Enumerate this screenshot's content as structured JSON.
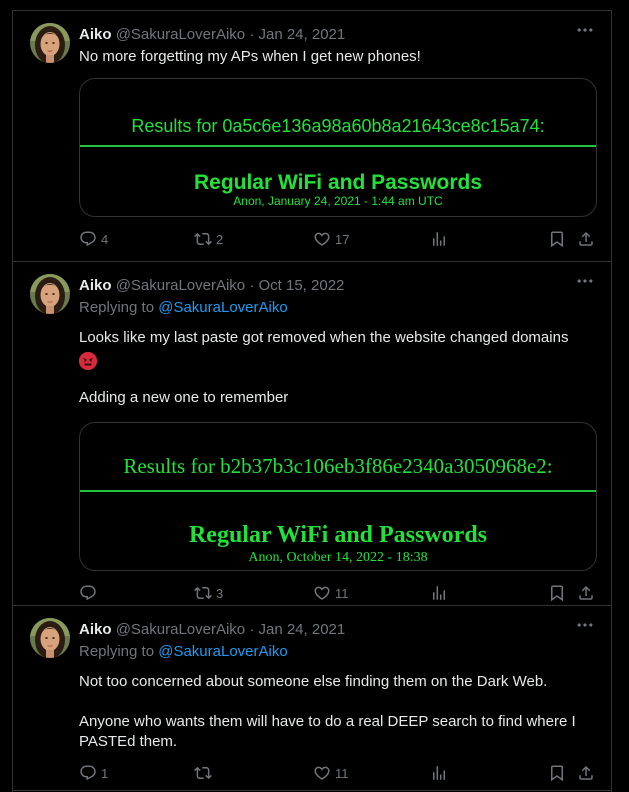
{
  "tweets": [
    {
      "name": "Aiko",
      "handle": "@SakuraLoverAiko",
      "date": "· Jan 24, 2021",
      "text": "No more forgetting my APs when I get new phones!",
      "card": {
        "results_line": "Results for 0a5c6e136a98a60b8a21643ce8c15a74:",
        "headline": "Regular WiFi and Passwords",
        "byline": "Anon, January 24, 2021 - 1:44 am UTC"
      },
      "counts": {
        "replies": "4",
        "reposts": "2",
        "likes": "17"
      }
    },
    {
      "name": "Aiko",
      "handle": "@SakuraLoverAiko",
      "date": "· Oct 15, 2022",
      "replying_prefix": "Replying to ",
      "replying_handle": "@SakuraLoverAiko",
      "text1": "Looks like my last paste got removed when the website changed domains",
      "emoji": "angry-face",
      "text2": "Adding a new one to remember",
      "card": {
        "results_line": "Results for b2b37b3c106eb3f86e2340a3050968e2:",
        "headline": "Regular WiFi and Passwords",
        "byline": "Anon, October 14, 2022 - 18:38"
      },
      "counts": {
        "replies": "",
        "reposts": "3",
        "likes": "11"
      }
    },
    {
      "name": "Aiko",
      "handle": "@SakuraLoverAiko",
      "date": "· Jan 24, 2021",
      "replying_prefix": "Replying to ",
      "replying_handle": "@SakuraLoverAiko",
      "text1": "Not too concerned about someone else finding them on the Dark Web.",
      "text2": "Anyone who wants them will have to do a real DEEP search to find where I PASTEd them.",
      "counts": {
        "replies": "1",
        "reposts": "",
        "likes": "11"
      }
    }
  ],
  "colors": {
    "background": "#000000",
    "text": "#e7e9ea",
    "muted": "#71767b",
    "link": "#1d9bf0",
    "terminal_green": "#22e23a",
    "border": "#2f3336"
  }
}
